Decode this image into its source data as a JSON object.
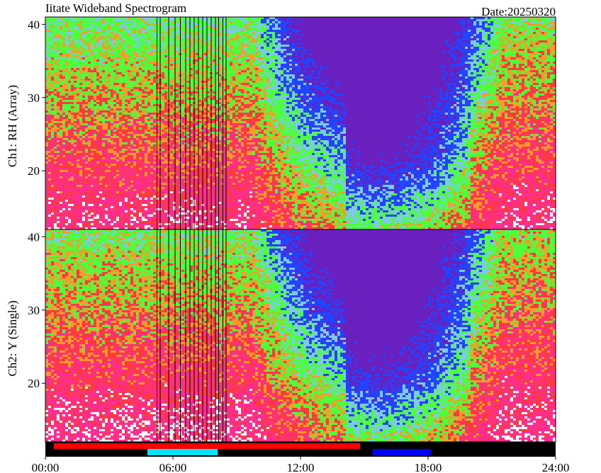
{
  "title": "Iitate Wideband Spectrogram",
  "date_label": "Date:20250320",
  "chart_data": [
    {
      "type": "heatmap",
      "name": "Ch1: RH (Array)",
      "ylabel": "Ch1: RH (Array)",
      "ylim": [
        12,
        41
      ],
      "yticks": [
        20,
        30,
        40
      ],
      "xlim": [
        0,
        24
      ],
      "xlabel": "",
      "grid": false,
      "description_of_intensity": "white (lowest) -> magenta/red -> orange -> green -> cyan -> blue -> purple (highest)",
      "colors": [
        "#ffffff",
        "#ff2d8f",
        "#ff3a3a",
        "#ff9a2a",
        "#4dff3a",
        "#7ec8e8",
        "#2244ff",
        "#6a1fbf"
      ]
    },
    {
      "type": "heatmap",
      "name": "Ch2: Y (Single)",
      "ylabel": "Ch2: Y (Single)",
      "ylim": [
        12,
        41
      ],
      "yticks": [
        20,
        30,
        40
      ],
      "xlim": [
        0,
        24
      ],
      "xlabel": "",
      "grid": false,
      "colors": [
        "#ffffff",
        "#ff2d8f",
        "#ff3a3a",
        "#ff9a2a",
        "#4dff3a",
        "#7ec8e8",
        "#2244ff",
        "#6a1fbf"
      ]
    }
  ],
  "xticks": [
    "00:00",
    "06:00",
    "12:00",
    "18:00",
    "24:00"
  ],
  "xtick_hours": [
    0,
    6,
    12,
    18,
    24
  ],
  "daylight_bar": [
    {
      "start": 0.4,
      "end": 14.8,
      "color": "#ff0000"
    },
    {
      "start": 4.8,
      "end": 8.1,
      "color": "#00e5ff"
    },
    {
      "start": 15.4,
      "end": 18.1,
      "color": "#0000ff"
    }
  ],
  "vertical_lines_hours": [
    5.25,
    5.4,
    5.8,
    6.1,
    6.35,
    6.6,
    6.8,
    7.0,
    7.2,
    7.4,
    7.6,
    7.8,
    8.0,
    8.15,
    8.35,
    8.5
  ]
}
